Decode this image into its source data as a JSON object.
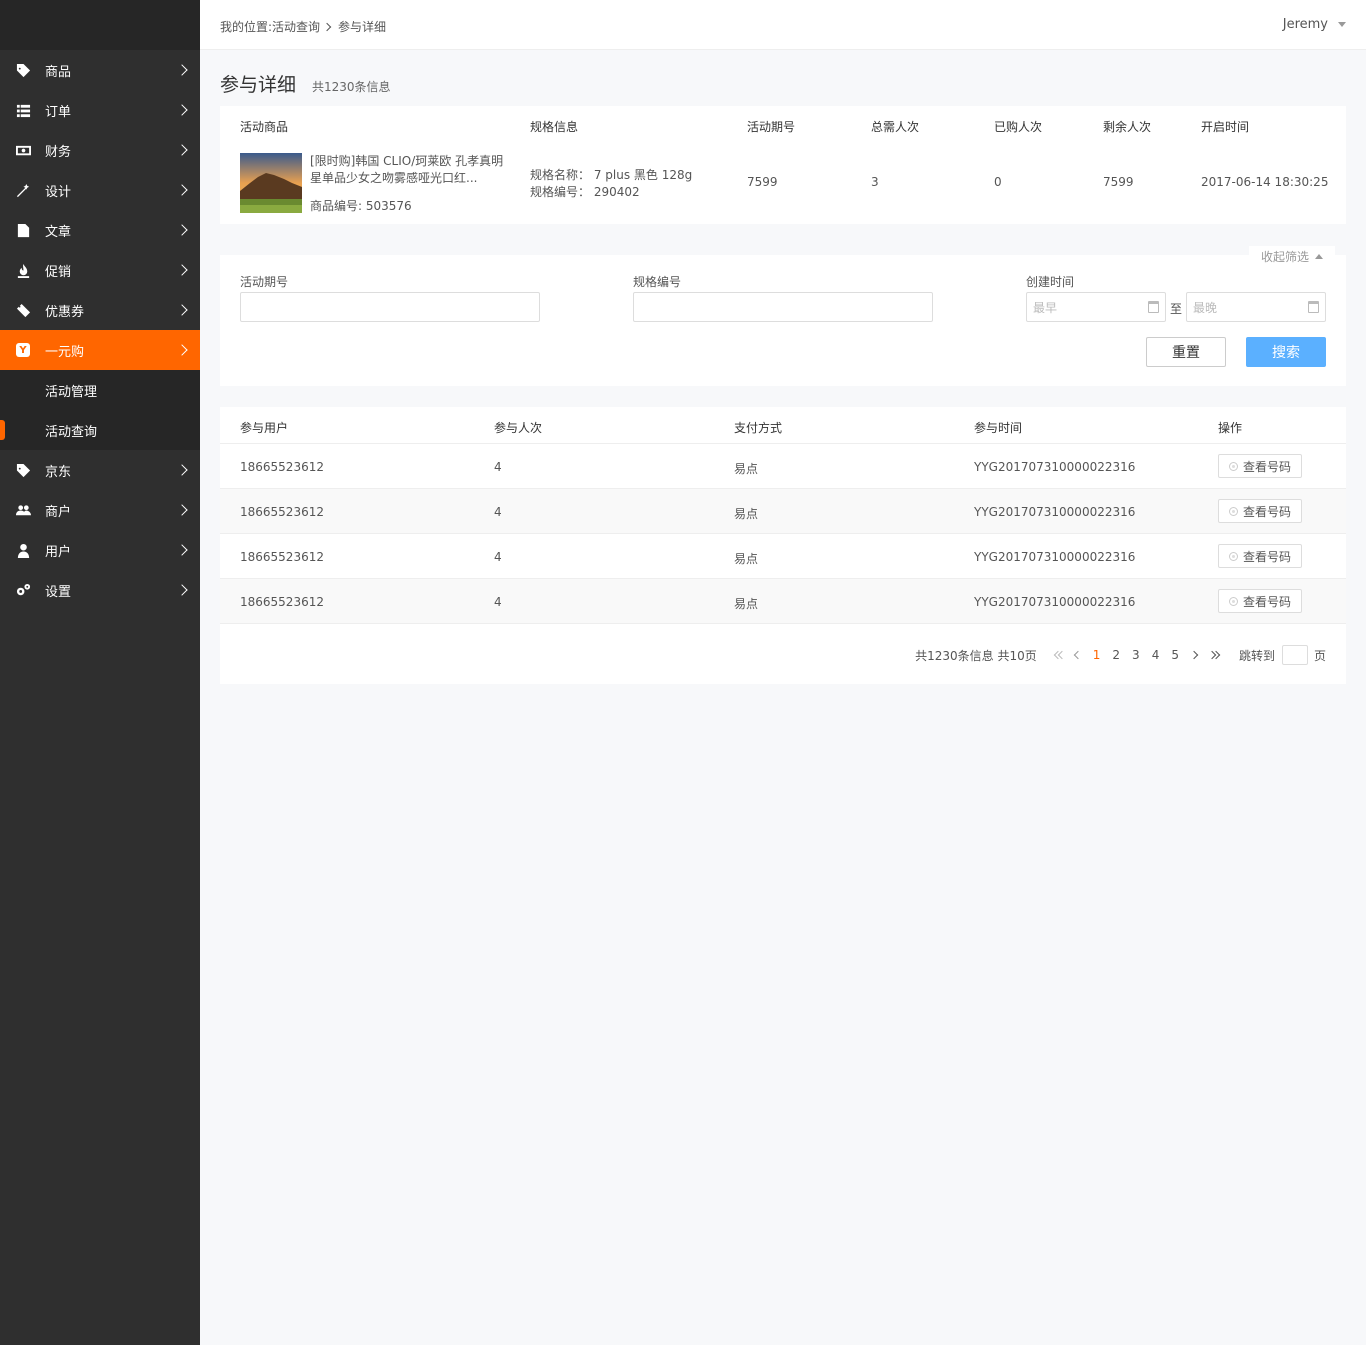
{
  "sidebar": {
    "items": [
      {
        "label": "商品",
        "icon": "tag-icon"
      },
      {
        "label": "订单",
        "icon": "list-icon"
      },
      {
        "label": "财务",
        "icon": "money-icon"
      },
      {
        "label": "设计",
        "icon": "magic-wand-icon"
      },
      {
        "label": "文章",
        "icon": "document-icon"
      },
      {
        "label": "促销",
        "icon": "fire-icon"
      },
      {
        "label": "优惠券",
        "icon": "ticket-icon"
      },
      {
        "label": "一元购",
        "icon": "yiyuan-icon",
        "badge": "Y"
      },
      {
        "label": "京东",
        "icon": "tag-icon"
      },
      {
        "label": "商户",
        "icon": "group-icon"
      },
      {
        "label": "用户",
        "icon": "user-icon"
      },
      {
        "label": "设置",
        "icon": "gears-icon"
      }
    ],
    "sub_items": [
      "活动管理",
      "活动查询"
    ],
    "active_color": "#ff6600"
  },
  "header": {
    "breadcrumb_prefix": "我的位置:活动查询",
    "breadcrumb_current": "参与详细",
    "user": "Jeremy"
  },
  "page": {
    "title": "参与详细",
    "count": "共1230条信息"
  },
  "product": {
    "headers": [
      "活动商品",
      "规格信息",
      "活动期号",
      "总需人次",
      "已购人次",
      "剩余人次",
      "开启时间"
    ],
    "name": "[限时购]韩国 CLIO/珂莱欧 孔孝真明星单品少女之吻雾感哑光口红...",
    "code": "商品编号: 503576",
    "spec_name": "规格名称： 7 plus 黑色 128g",
    "spec_code": "规格编号： 290402",
    "period": "7599",
    "total": "3",
    "bought": "0",
    "remaining": "7599",
    "start_time": "2017-06-14 18:30:25"
  },
  "filter": {
    "collapse_label": "收起筛选",
    "period_label": "活动期号",
    "spec_label": "规格编号",
    "created_label": "创建时间",
    "earliest_placeholder": "最早",
    "latest_placeholder": "最晚",
    "to": "至",
    "reset": "重置",
    "search": "搜索"
  },
  "table": {
    "headers": [
      "参与用户",
      "参与人次",
      "支付方式",
      "参与时间",
      "操作"
    ],
    "rows": [
      {
        "user": "18665523612",
        "times": "4",
        "pay": "易点",
        "time": "YYG201707310000022316",
        "action": "查看号码"
      },
      {
        "user": "18665523612",
        "times": "4",
        "pay": "易点",
        "time": "YYG201707310000022316",
        "action": "查看号码"
      },
      {
        "user": "18665523612",
        "times": "4",
        "pay": "易点",
        "time": "YYG201707310000022316",
        "action": "查看号码"
      },
      {
        "user": "18665523612",
        "times": "4",
        "pay": "易点",
        "time": "YYG201707310000022316",
        "action": "查看号码"
      }
    ]
  },
  "pager": {
    "summary": "共1230条信息 共10页",
    "pages": [
      "1",
      "2",
      "3",
      "4",
      "5"
    ],
    "current": "1",
    "jump_label": "跳转到",
    "page_suffix": "页"
  }
}
